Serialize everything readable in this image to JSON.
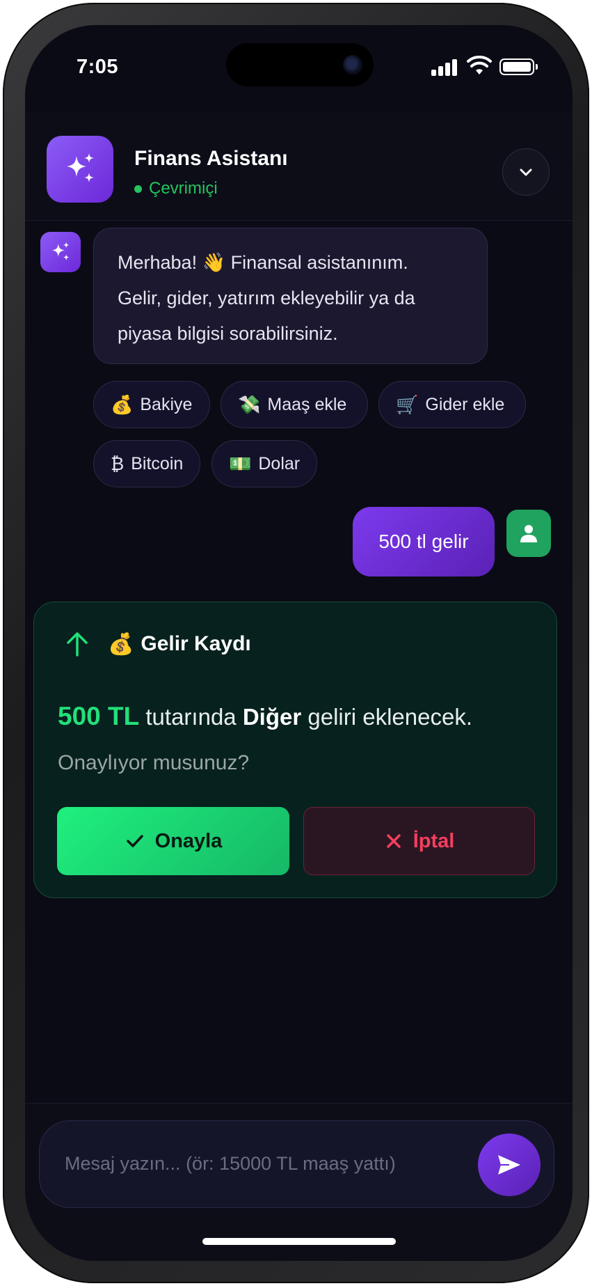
{
  "status_bar": {
    "time": "7:05"
  },
  "header": {
    "title": "Finans Asistanı",
    "status": "Çevrimiçi",
    "icon": "sparkles-icon"
  },
  "bot_message": {
    "text_line1": "Merhaba! 👋 Finansal asistanınım.",
    "text_line2": "Gelir, gider, yatırım ekleyebilir ya da",
    "text_line3": "piyasa bilgisi sorabilirsiniz."
  },
  "quick_actions": [
    {
      "emoji": "💰",
      "label": "Bakiye"
    },
    {
      "emoji": "💸",
      "label": "Maaş ekle"
    },
    {
      "emoji": "🛒",
      "label": "Gider ekle"
    },
    {
      "emoji": "₿",
      "label": "Bitcoin"
    },
    {
      "emoji": "💵",
      "label": "Dolar"
    }
  ],
  "user_message": {
    "text": "500 tl gelir"
  },
  "confirm_card": {
    "title_emoji": "💰",
    "title": "Gelir Kaydı",
    "amount": "500 TL",
    "text_mid": "tutarında",
    "category": "Diğer",
    "text_end": "geliri eklenecek.",
    "question": "Onaylıyor musunuz?",
    "confirm_label": "Onayla",
    "cancel_label": "İptal"
  },
  "composer": {
    "placeholder": "Mesaj yazın... (ör: 15000 TL maaş yattı)"
  },
  "colors": {
    "accent": "#7c3aed",
    "success": "#22e07a",
    "danger": "#f43f5e",
    "background": "#0b0b15"
  }
}
